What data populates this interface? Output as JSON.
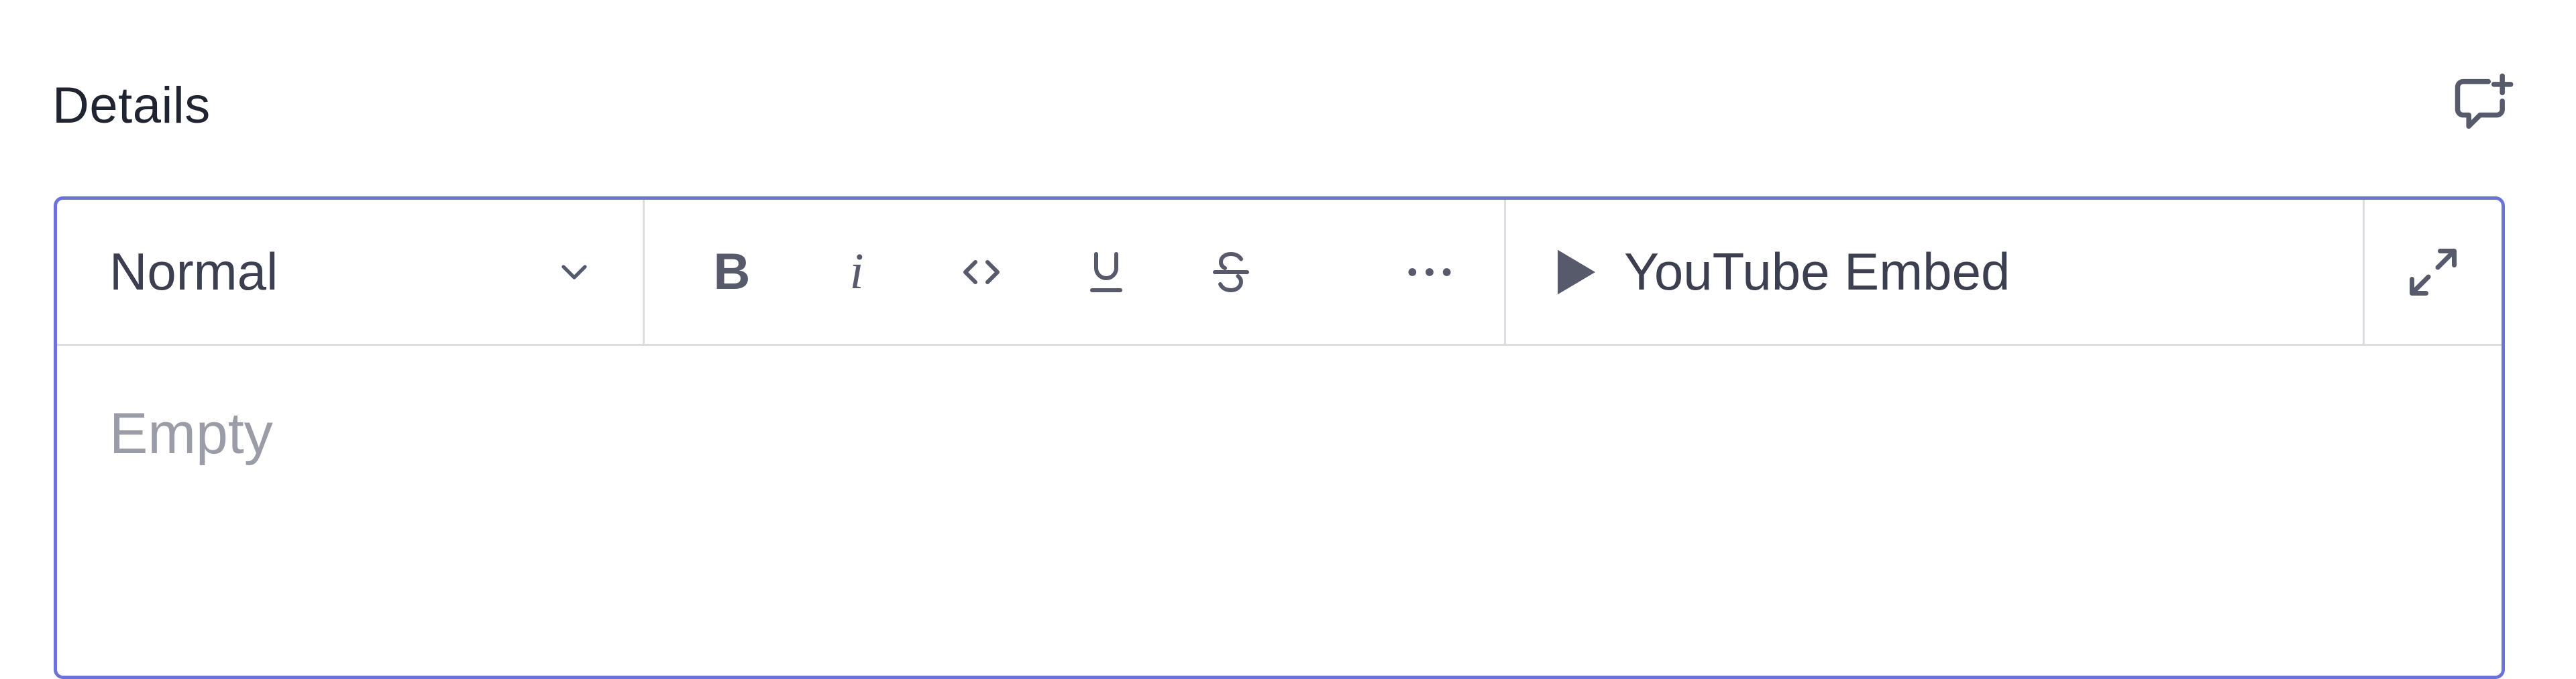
{
  "field": {
    "label": "Details",
    "comment_icon": "add-comment-icon"
  },
  "toolbar": {
    "style_select": {
      "value": "Normal",
      "icon": "chevron-down-icon"
    },
    "format_buttons": [
      {
        "name": "bold",
        "glyph": "B"
      },
      {
        "name": "italic",
        "glyph": "i"
      },
      {
        "name": "code",
        "icon": "code-icon"
      },
      {
        "name": "underline",
        "icon": "underline-icon"
      },
      {
        "name": "strikethrough",
        "icon": "strikethrough-icon"
      },
      {
        "name": "more",
        "icon": "more-horizontal-icon"
      }
    ],
    "embed": {
      "label": "YouTube Embed",
      "icon": "play-icon"
    },
    "expand_icon": "expand-icon"
  },
  "editor": {
    "placeholder": "Empty"
  },
  "colors": {
    "focus_border": "#6b73db",
    "text": "#3b3f4f",
    "placeholder": "#9a9ca6"
  }
}
